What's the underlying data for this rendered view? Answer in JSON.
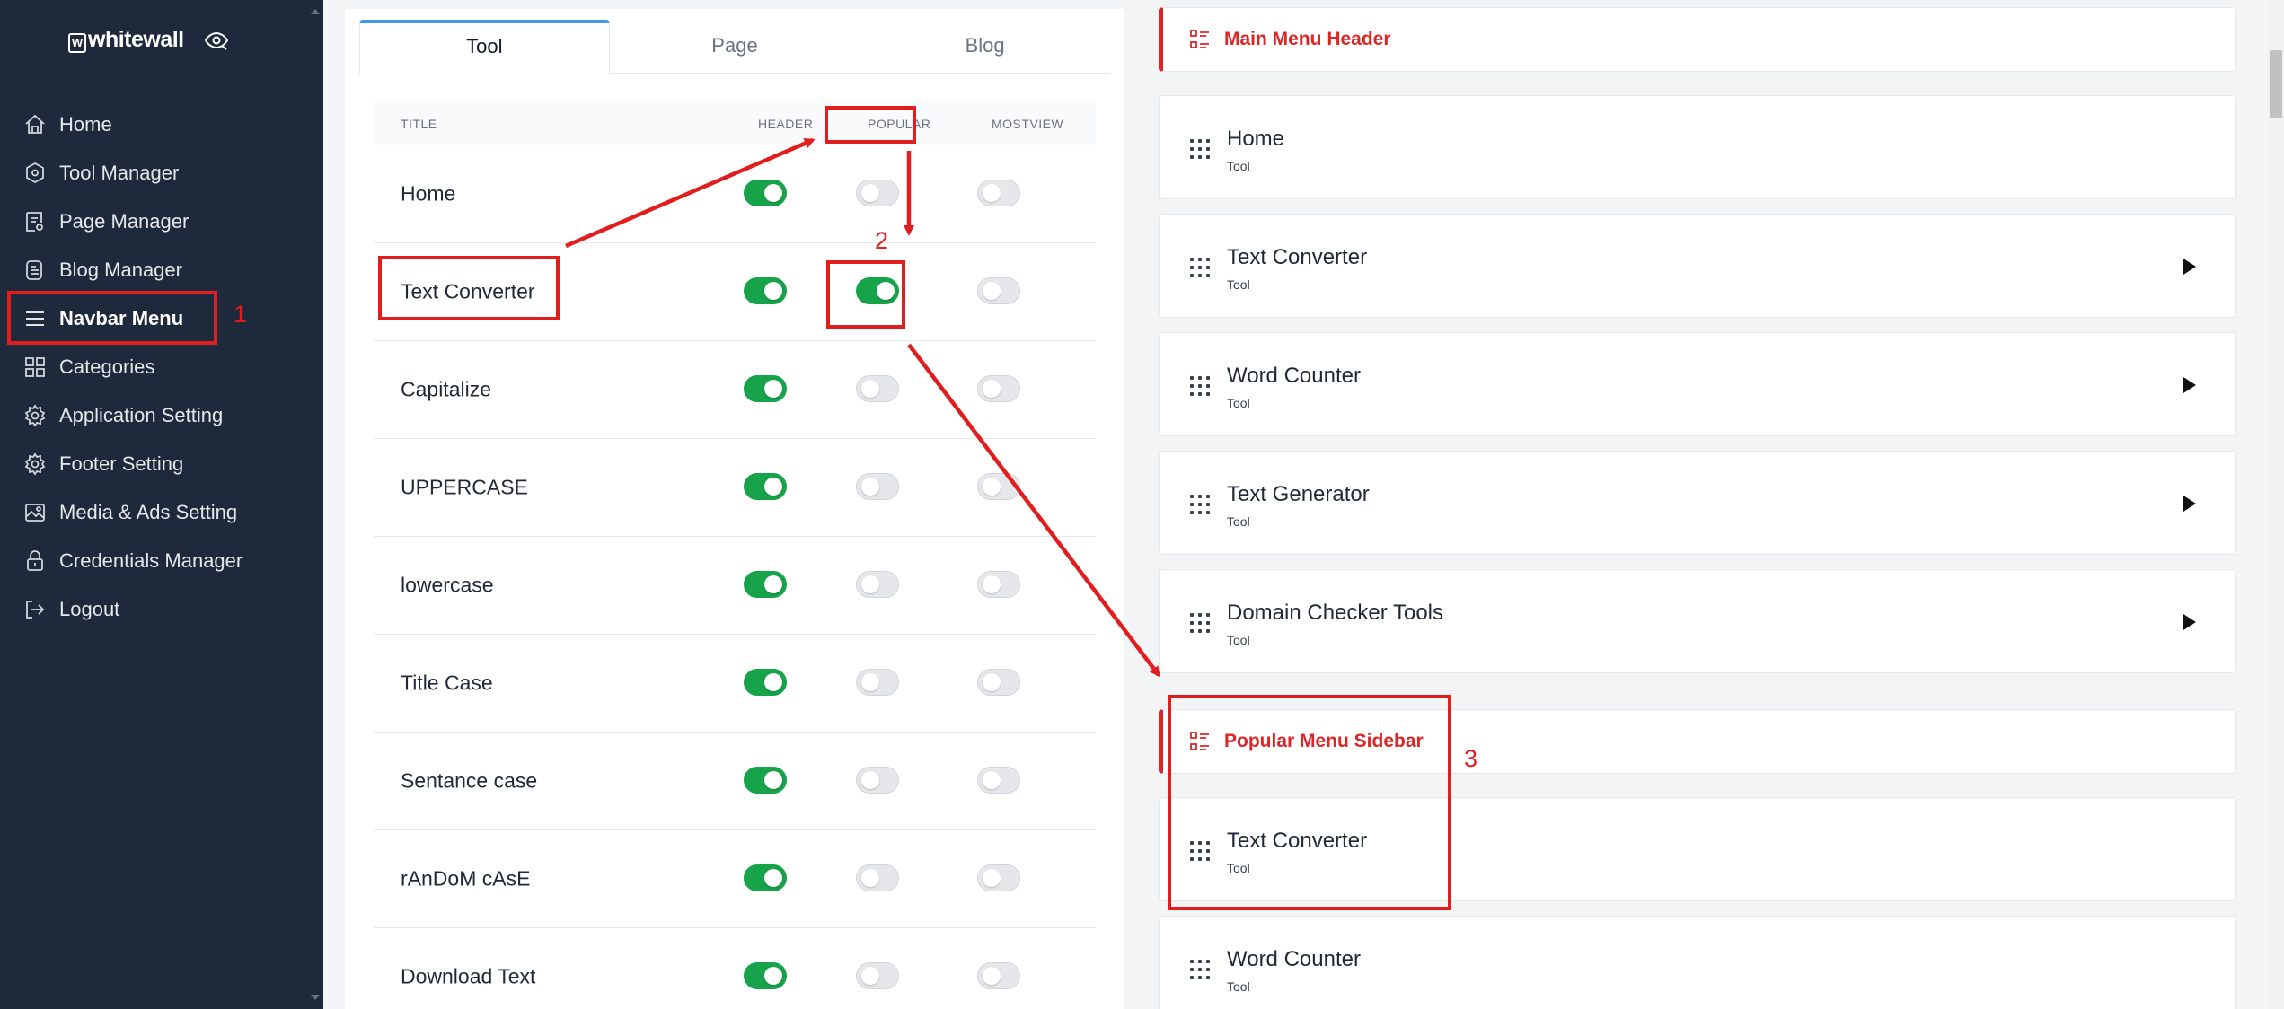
{
  "sidebar": {
    "logo_text": "whitewall",
    "logo_mark": "W",
    "items": [
      {
        "label": "Home",
        "icon": "home-icon"
      },
      {
        "label": "Tool Manager",
        "icon": "hexagon-icon"
      },
      {
        "label": "Page Manager",
        "icon": "page-icon"
      },
      {
        "label": "Blog Manager",
        "icon": "blog-icon"
      },
      {
        "label": "Navbar Menu",
        "icon": "menu-icon",
        "active": true
      },
      {
        "label": "Categories",
        "icon": "grid-icon"
      },
      {
        "label": "Application Setting",
        "icon": "gear-icon"
      },
      {
        "label": "Footer Setting",
        "icon": "gear-icon"
      },
      {
        "label": "Media & Ads Setting",
        "icon": "image-icon"
      },
      {
        "label": "Credentials Manager",
        "icon": "lock-icon"
      },
      {
        "label": "Logout",
        "icon": "logout-icon"
      }
    ]
  },
  "tabs": [
    "Tool",
    "Page",
    "Blog"
  ],
  "table": {
    "headers": {
      "title": "TITLE",
      "header": "HEADER",
      "popular": "POPULAR",
      "mostview": "MOSTVIEW"
    },
    "rows": [
      {
        "title": "Home",
        "header": true,
        "popular": false,
        "mostview": false
      },
      {
        "title": "Text Converter",
        "header": true,
        "popular": true,
        "mostview": false
      },
      {
        "title": "Capitalize",
        "header": true,
        "popular": false,
        "mostview": false
      },
      {
        "title": "UPPERCASE",
        "header": true,
        "popular": false,
        "mostview": false
      },
      {
        "title": "lowercase",
        "header": true,
        "popular": false,
        "mostview": false
      },
      {
        "title": "Title Case",
        "header": true,
        "popular": false,
        "mostview": false
      },
      {
        "title": "Sentance case",
        "header": true,
        "popular": false,
        "mostview": false
      },
      {
        "title": "rAnDoM cAsE",
        "header": true,
        "popular": false,
        "mostview": false
      },
      {
        "title": "Download Text",
        "header": true,
        "popular": false,
        "mostview": false
      }
    ]
  },
  "main_menu": {
    "title": "Main Menu Header",
    "items": [
      {
        "name": "Home",
        "sub": "Tool",
        "has_children": false
      },
      {
        "name": "Text Converter",
        "sub": "Tool",
        "has_children": true
      },
      {
        "name": "Word Counter",
        "sub": "Tool",
        "has_children": true
      },
      {
        "name": "Text Generator",
        "sub": "Tool",
        "has_children": true
      },
      {
        "name": "Domain Checker Tools",
        "sub": "Tool",
        "has_children": true
      }
    ]
  },
  "popular_menu": {
    "title": "Popular Menu Sidebar",
    "items": [
      {
        "name": "Text Converter",
        "sub": "Tool"
      },
      {
        "name": "Word Counter",
        "sub": "Tool"
      }
    ]
  },
  "annotations": {
    "n1": "1",
    "n2": "2",
    "n3": "3",
    "color": "#e11d1d"
  },
  "colors": {
    "sidebar_bg": "#1e293b",
    "accent_red": "#dc2626",
    "toggle_on": "#16a34a",
    "tab_active": "#3b9ae1"
  }
}
